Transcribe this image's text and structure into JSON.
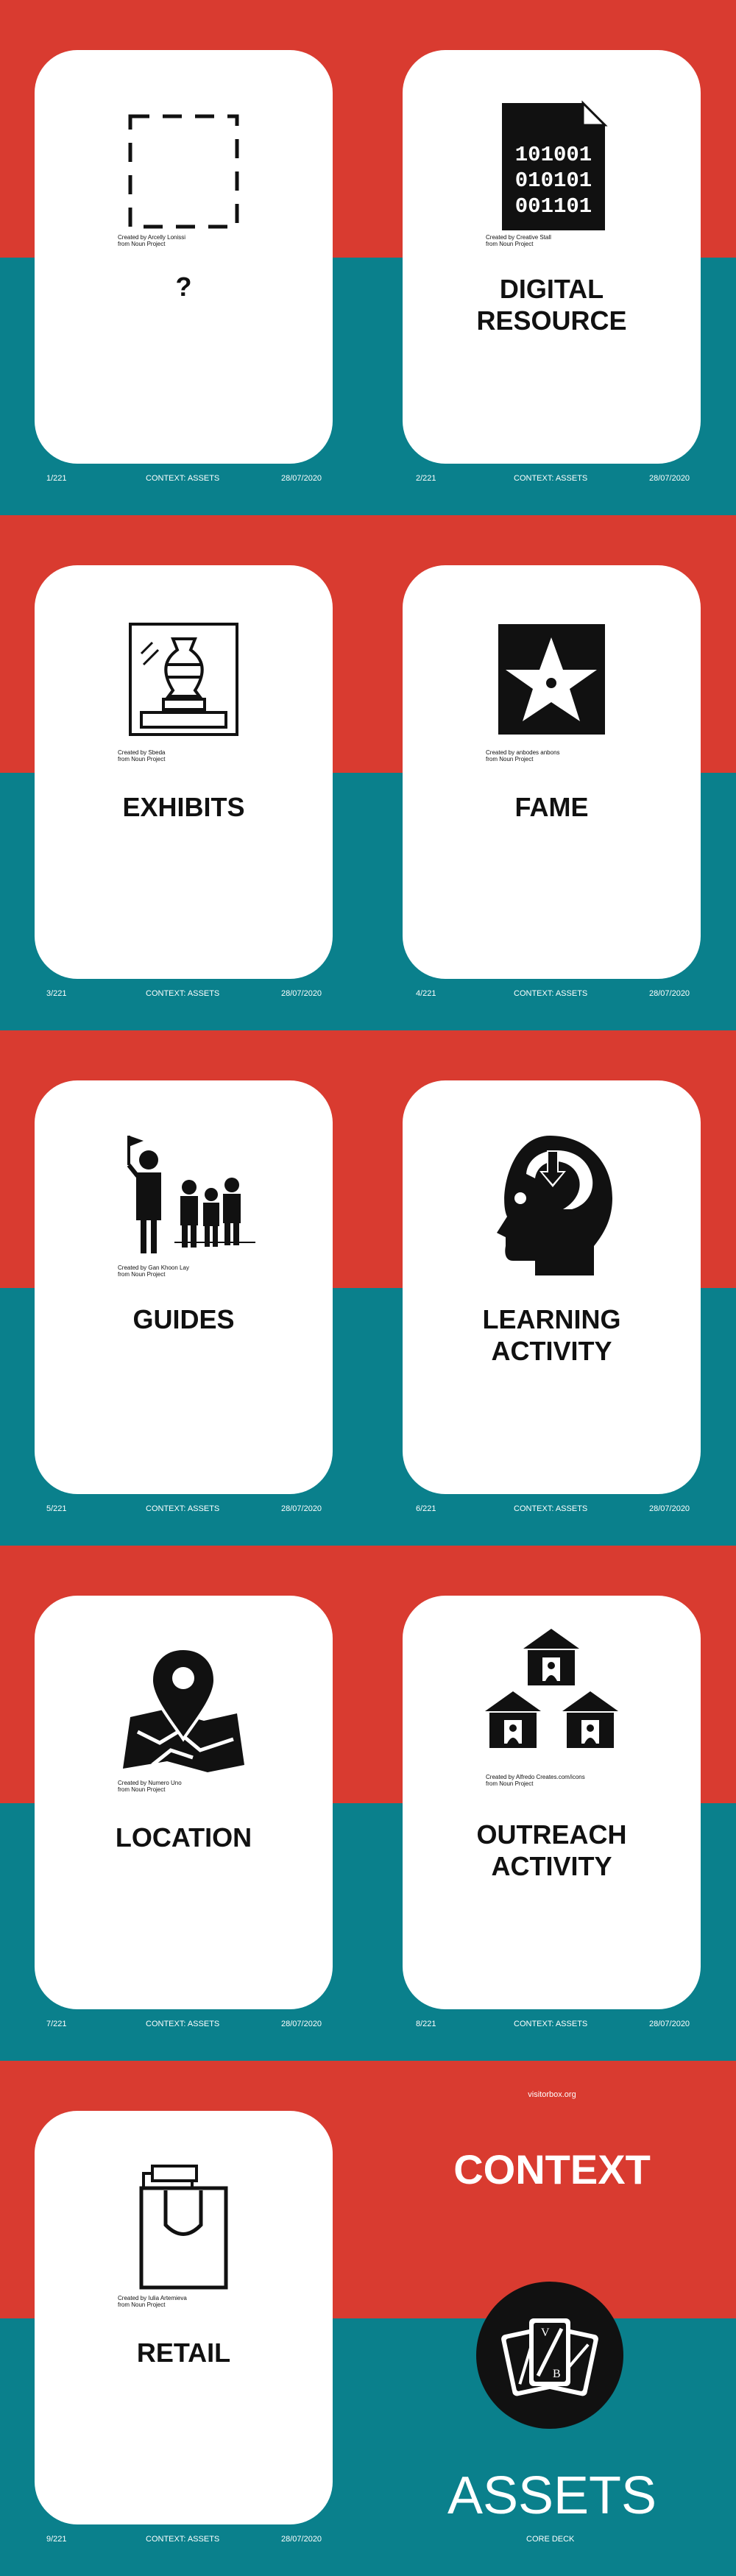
{
  "cards": [
    {
      "label": "?",
      "credit1": "Created by Arcelly Lonissi",
      "credit2": "from Noun Project",
      "num": "1/221",
      "context": "CONTEXT: ASSETS",
      "date": "28/07/2020",
      "icon": "dashed-square-icon"
    },
    {
      "label": "DIGITAL\nRESOURCE",
      "credit1": "Created by Creative Stall",
      "credit2": "from Noun Project",
      "num": "2/221",
      "context": "CONTEXT: ASSETS",
      "date": "28/07/2020",
      "icon": "binary-file-icon"
    },
    {
      "label": "EXHIBITS",
      "credit1": "Created by Sbeda",
      "credit2": "from Noun Project",
      "num": "3/221",
      "context": "CONTEXT: ASSETS",
      "date": "28/07/2020",
      "icon": "vase-exhibit-icon"
    },
    {
      "label": "FAME",
      "credit1": "Created by anbodes anbons",
      "credit2": "from Noun Project",
      "num": "4/221",
      "context": "CONTEXT: ASSETS",
      "date": "28/07/2020",
      "icon": "star-icon"
    },
    {
      "label": "GUIDES",
      "credit1": "Created by Gan Khoon Lay",
      "credit2": "from Noun Project",
      "num": "5/221",
      "context": "CONTEXT: ASSETS",
      "date": "28/07/2020",
      "icon": "tour-guide-icon"
    },
    {
      "label": "LEARNING\nACTIVITY",
      "credit1": "",
      "credit2": "",
      "num": "6/221",
      "context": "CONTEXT: ASSETS",
      "date": "28/07/2020",
      "icon": "learning-head-icon"
    },
    {
      "label": "LOCATION",
      "credit1": "Created by Numero Uno",
      "credit2": "from Noun Project",
      "num": "7/221",
      "context": "CONTEXT: ASSETS",
      "date": "28/07/2020",
      "icon": "map-pin-icon"
    },
    {
      "label": "OUTREACH\nACTIVITY",
      "credit1": "Created by Alfredo Creates.com/icons",
      "credit2": "from Noun Project",
      "num": "8/221",
      "context": "CONTEXT: ASSETS",
      "date": "28/07/2020",
      "icon": "houses-people-icon"
    },
    {
      "label": "RETAIL",
      "credit1": "Created by Iulia Artemieva",
      "credit2": "from Noun Project",
      "num": "9/221",
      "context": "CONTEXT: ASSETS",
      "date": "28/07/2020",
      "icon": "shopping-bag-icon"
    }
  ],
  "final": {
    "site": "visitorbox.org",
    "title": "CONTEXT",
    "subtitle": "ASSETS",
    "deck": "CORE DECK",
    "logo_icon": "vb-cards-logo-icon",
    "logo_letters": [
      "V",
      "B"
    ]
  },
  "colors": {
    "red": "#d93b30",
    "teal": "#0a808c",
    "card": "#ffffff",
    "ink": "#111111"
  }
}
